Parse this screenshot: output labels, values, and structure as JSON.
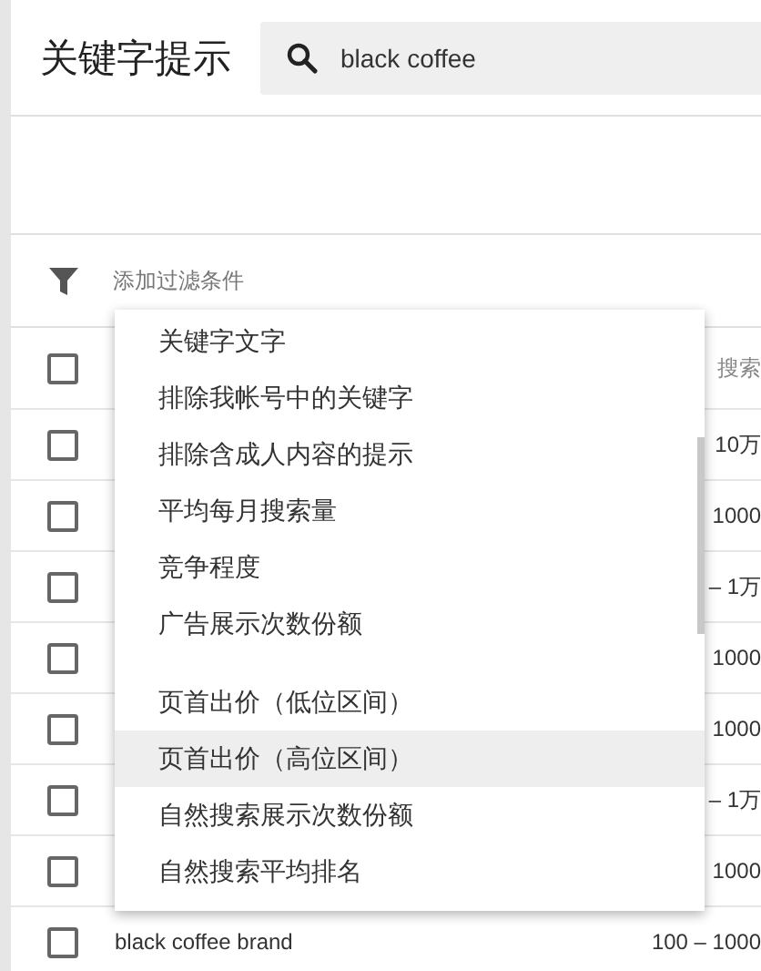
{
  "header": {
    "title": "关键字提示",
    "search": {
      "value": "black coffee"
    }
  },
  "filter": {
    "placeholder": "添加过滤条件"
  },
  "table": {
    "header": {
      "checked": false,
      "column_3": "搜索"
    },
    "rows": [
      {
        "checked": false,
        "column_3": "10万"
      },
      {
        "checked": false,
        "column_3": "1000"
      },
      {
        "checked": false,
        "column_3": "– 1万"
      },
      {
        "checked": false,
        "column_3": "1000"
      },
      {
        "checked": false,
        "column_3": "1000"
      },
      {
        "checked": false,
        "column_3": "– 1万"
      },
      {
        "checked": false,
        "column_3": "1000"
      },
      {
        "checked": false,
        "keyword": "black coffee brand",
        "column_3": "100 – 1000"
      }
    ]
  },
  "menu": {
    "groups": [
      [
        {
          "label": "关键字文字",
          "selected": false
        },
        {
          "label": "排除我帐号中的关键字",
          "selected": false
        },
        {
          "label": "排除含成人内容的提示",
          "selected": false
        },
        {
          "label": "平均每月搜索量",
          "selected": false
        },
        {
          "label": "竞争程度",
          "selected": false
        },
        {
          "label": "广告展示次数份额",
          "selected": false
        }
      ],
      [
        {
          "label": "页首出价（低位区间）",
          "selected": false
        },
        {
          "label": "页首出价（高位区间）",
          "selected": true
        },
        {
          "label": "自然搜索展示次数份额",
          "selected": false
        },
        {
          "label": "自然搜索平均排名",
          "selected": false
        }
      ]
    ]
  }
}
